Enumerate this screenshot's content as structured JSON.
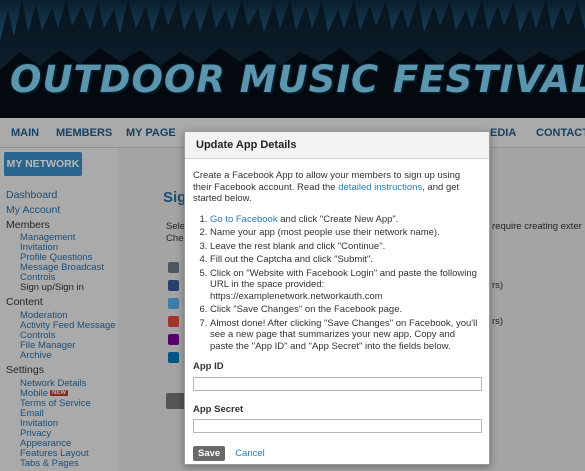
{
  "banner": {
    "title": "OUTDOOR MUSIC FESTIVALS"
  },
  "nav": {
    "items": [
      "MAIN",
      "MEMBERS",
      "MY PAGE",
      "EDIA",
      "CONTACT"
    ]
  },
  "sidebar": {
    "network_button": "MY NETWORK",
    "top_links": [
      "Dashboard",
      "My Account"
    ],
    "members": {
      "heading": "Members",
      "items": [
        "Management",
        "Invitation",
        "Profile Questions",
        "Message Broadcast",
        "Controls",
        "Sign up/Sign in"
      ]
    },
    "content": {
      "heading": "Content",
      "items": [
        "Moderation",
        "Activity Feed Message",
        "Controls",
        "File Manager",
        "Archive"
      ]
    },
    "settings": {
      "heading": "Settings",
      "items": [
        "Network Details",
        "Mobile",
        "Terms of Service",
        "Email",
        "Invitation",
        "Privacy",
        "Appearance",
        "Features Layout",
        "Tabs & Pages"
      ],
      "new_badge": "NEW"
    }
  },
  "background": {
    "title": "Sig",
    "line1": "Sele",
    "line1_right": "require creating exter",
    "line2": "Chec",
    "row_suffix": "rs)"
  },
  "modal": {
    "title": "Update App Details",
    "intro_before": "Create a Facebook App to allow your members to sign up using their Facebook account. Read the ",
    "intro_link": "detailed instructions",
    "intro_after": ", and get started below.",
    "step1_link": "Go to Facebook",
    "step1_rest": " and click \"Create New App\".",
    "steps": [
      "Name your app (most people use their network name).",
      "Leave the rest blank and click \"Continue\".",
      "Fill out the Captcha and click \"Submit\".",
      "Click on \"Website with Facebook Login\" and paste the following URL in the space provided: https://examplenetwork.networkauth.com",
      "Click \"Save Changes\" on the Facebook page.",
      "Almost done! After clicking \"Save Changes\" on Facebook, you'll see a new page that summarizes your new app. Copy and paste the \"App ID\" and \"App Secret\" into the fields below."
    ],
    "app_id_label": "App ID",
    "app_id_value": "",
    "app_secret_label": "App Secret",
    "app_secret_value": "",
    "save_label": "Save",
    "cancel_label": "Cancel"
  }
}
